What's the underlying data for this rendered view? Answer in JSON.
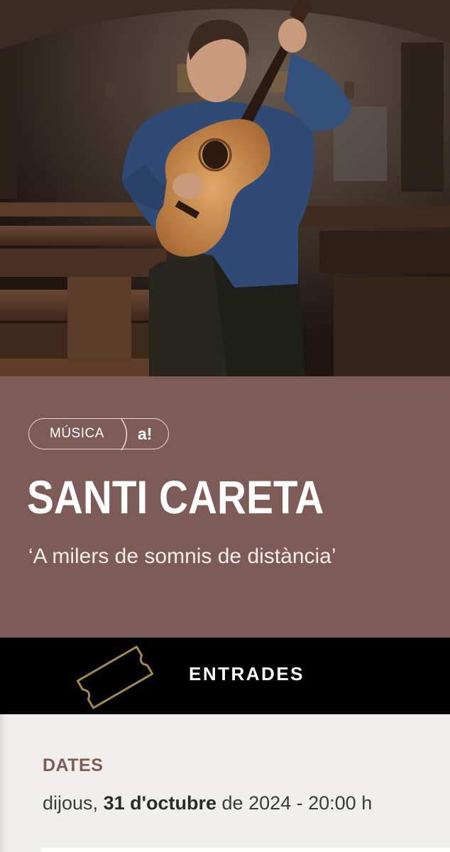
{
  "hero": {
    "photo_alt": "Santi Careta playing classical guitar in a church"
  },
  "tags": {
    "category": "MÚSICA",
    "logo": "a!"
  },
  "event": {
    "title": "SANTI CARETA",
    "subtitle": "‘A milers de somnis de distància’"
  },
  "tickets": {
    "label": "ENTRADES",
    "icon": "ticket-icon"
  },
  "dates": {
    "heading": "DATES",
    "weekday": "dijous, ",
    "day_month": "31 d'octubre",
    "rest": " de 2024 - 20:00 h"
  },
  "colors": {
    "accent": "#7d5c58",
    "ticket_bar": "#000000",
    "ticket_icon": "#a38a4f",
    "background": "#f0efeb"
  }
}
